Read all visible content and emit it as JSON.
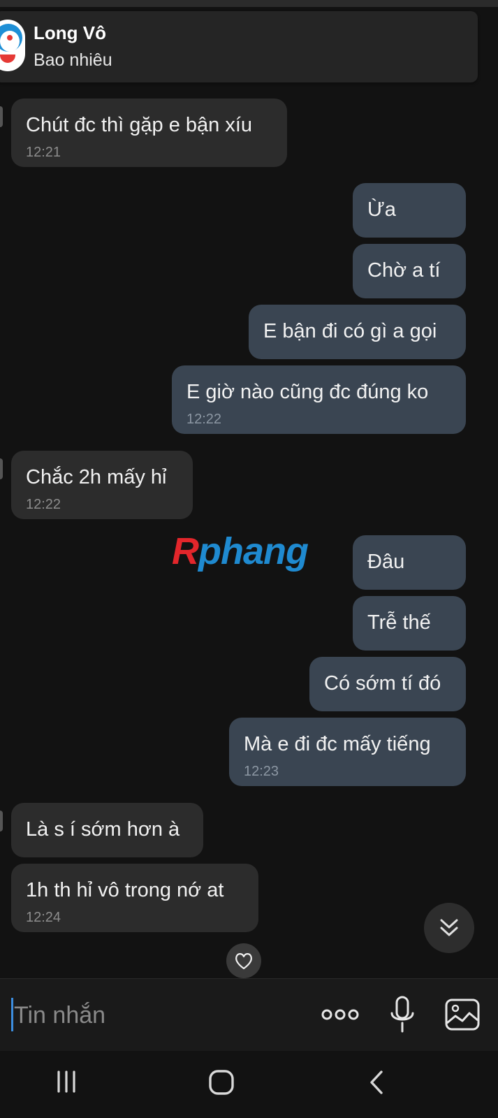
{
  "header": {
    "contact_name": "Long Vô",
    "status_text": "Bao nhiêu"
  },
  "messages": [
    {
      "dir": "in",
      "text": "Chút đc thì gặp e bận xíu",
      "time": "12:21"
    },
    {
      "dir": "out",
      "text": "Ừa",
      "time": ""
    },
    {
      "dir": "out",
      "text": "Chờ a tí",
      "time": ""
    },
    {
      "dir": "out",
      "text": "E bận đi có gì a gọi",
      "time": ""
    },
    {
      "dir": "out",
      "text": "E giờ nào cũng đc đúng ko",
      "time": "12:22"
    },
    {
      "dir": "in",
      "text": "Chắc 2h mấy hỉ",
      "time": "12:22"
    },
    {
      "dir": "out",
      "text": "Đâu",
      "time": ""
    },
    {
      "dir": "out",
      "text": "Trễ thế",
      "time": ""
    },
    {
      "dir": "out",
      "text": "Có sớm tí đó",
      "time": ""
    },
    {
      "dir": "out",
      "text": "Mà e đi đc mấy tiếng",
      "time": "12:23"
    },
    {
      "dir": "in",
      "text": "Là s í sớm hơn à",
      "time": ""
    },
    {
      "dir": "in",
      "text": "1h th hỉ vô trong nớ at",
      "time": "12:24"
    }
  ],
  "watermark": {
    "part1": "R",
    "part2": "phang"
  },
  "composer": {
    "placeholder": "Tin nhắn",
    "more_icon": "more-dots-icon",
    "mic_icon": "microphone-icon",
    "gallery_icon": "image-gallery-icon"
  },
  "icons": {
    "scroll_down": "double-chevron-down-icon",
    "reaction": "heart-icon"
  },
  "navbar": {
    "recents": "recent-apps-icon",
    "home": "home-icon",
    "back": "back-icon"
  },
  "colors": {
    "background": "#121212",
    "incoming_bubble": "#2c2c2c",
    "outgoing_bubble": "#3a4552",
    "cursor_accent": "#3c8dde"
  }
}
